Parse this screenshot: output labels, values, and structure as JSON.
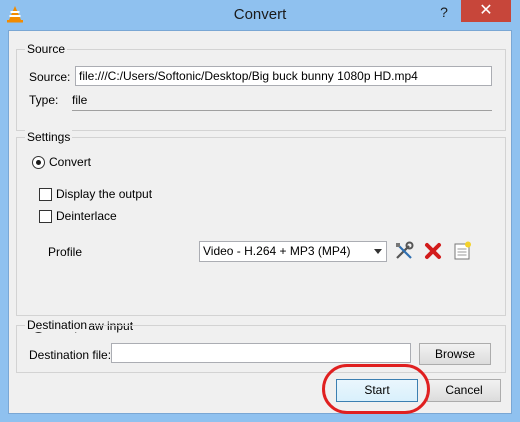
{
  "window": {
    "title": "Convert",
    "help": "?",
    "close": "✕"
  },
  "source": {
    "group_label": "Source",
    "source_label": "Source:",
    "source_value": "file:///C:/Users/Softonic/Desktop/Big buck bunny 1080p HD.mp4",
    "type_label": "Type:",
    "type_value": "file"
  },
  "settings": {
    "group_label": "Settings",
    "convert_label": "Convert",
    "display_output_label": "Display the output",
    "deinterlace_label": "Deinterlace",
    "profile_label": "Profile",
    "profile_selected": "Video - H.264 + MP3 (MP4)",
    "dump_raw_label": "Dump raw input"
  },
  "destination": {
    "group_label": "Destination",
    "file_label": "Destination file:",
    "file_value": "",
    "browse_label": "Browse"
  },
  "actions": {
    "start_label": "Start",
    "cancel_label": "Cancel"
  },
  "colors": {
    "highlight": "#e02020",
    "title_bar": "#8fc1ef",
    "close_button": "#c7463a"
  }
}
